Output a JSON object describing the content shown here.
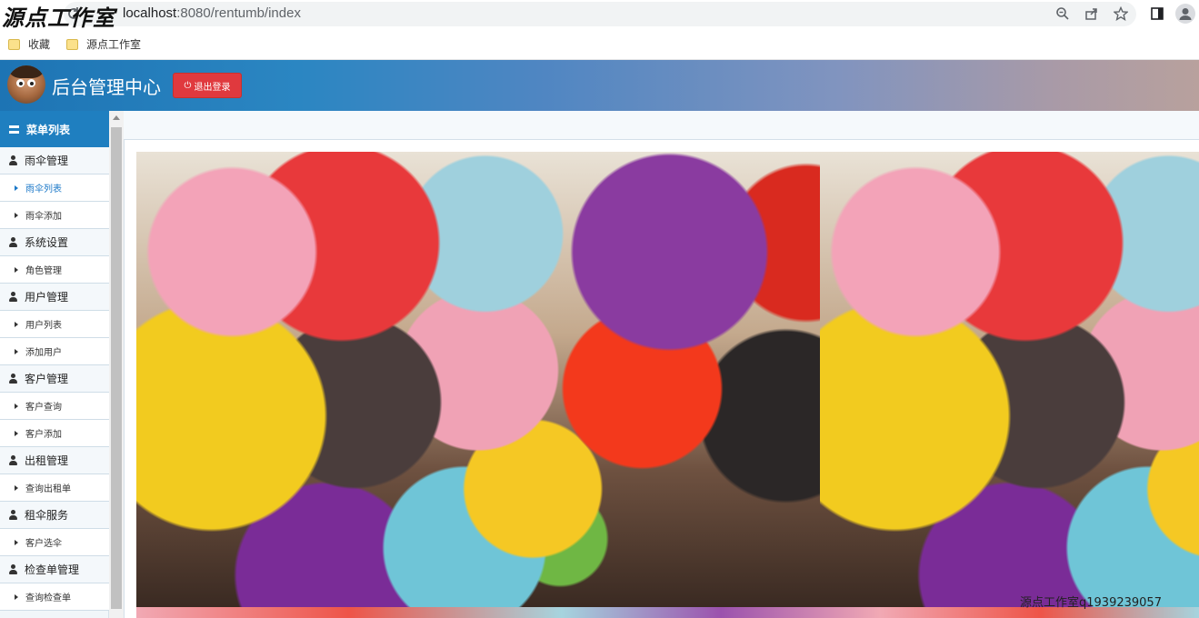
{
  "browser": {
    "watermark": "源点工作室",
    "url_host": "localhost",
    "url_rest": ":8080/rentumb/index",
    "bookmarks": [
      {
        "label": "收藏",
        "icon": "folder-icon"
      },
      {
        "label": "源点工作室",
        "icon": "folder-icon"
      }
    ],
    "icons": [
      "zoom-icon",
      "share-icon",
      "star-icon",
      "sidebar-toggle-icon",
      "profile-icon"
    ]
  },
  "header": {
    "title": "后台管理中心",
    "logout_label": "退出登录",
    "logout_icon": "power-icon"
  },
  "sidebar": {
    "menu_title": "菜单列表",
    "items": [
      {
        "type": "group",
        "label": "雨伞管理"
      },
      {
        "type": "sub",
        "label": "雨伞列表",
        "active": true
      },
      {
        "type": "sub",
        "label": "雨伞添加"
      },
      {
        "type": "group",
        "label": "系统设置"
      },
      {
        "type": "sub",
        "label": "角色管理"
      },
      {
        "type": "group",
        "label": "用户管理"
      },
      {
        "type": "sub",
        "label": "用户列表"
      },
      {
        "type": "sub",
        "label": "添加用户"
      },
      {
        "type": "group",
        "label": "客户管理"
      },
      {
        "type": "sub",
        "label": "客户查询"
      },
      {
        "type": "sub",
        "label": "客户添加"
      },
      {
        "type": "group",
        "label": "出租管理"
      },
      {
        "type": "sub",
        "label": "查询出租单"
      },
      {
        "type": "group",
        "label": "租伞服务"
      },
      {
        "type": "sub",
        "label": "客户选伞"
      },
      {
        "type": "group",
        "label": "检查单管理"
      },
      {
        "type": "sub",
        "label": "查询检查单"
      }
    ]
  },
  "content": {
    "image_description_icon": "umbrellas-photo",
    "qq_watermark": "源点工作室q1939239057"
  },
  "colors": {
    "accent": "#1f7fc0",
    "logout": "#e0393e",
    "active_link": "#1b78c8"
  }
}
